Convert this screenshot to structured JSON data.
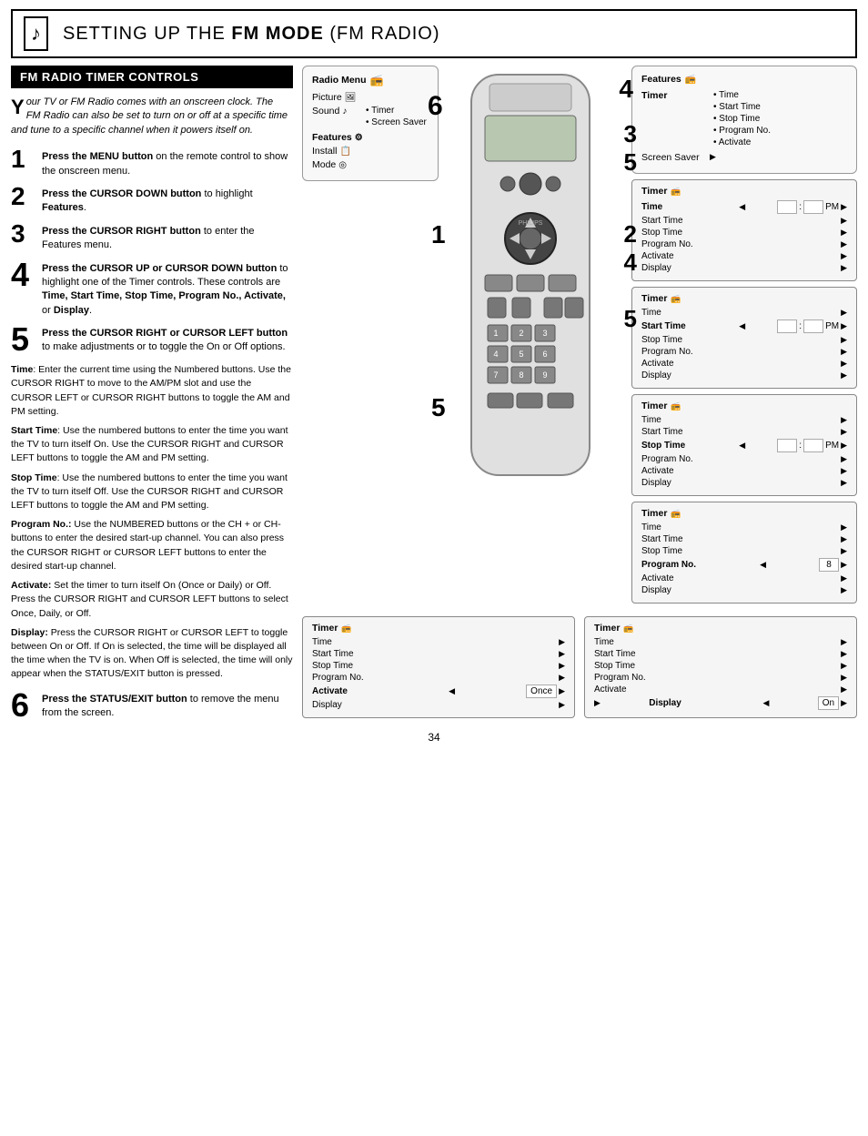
{
  "header": {
    "icon": "♪",
    "title_pre": "Setting up the ",
    "title_bold": "FM Mode",
    "title_post": " (FM Radio)"
  },
  "section_title": "FM Radio Timer Controls",
  "intro": {
    "drop_cap": "Y",
    "text": "our TV or FM Radio comes with an onscreen clock. The FM Radio can also be set to turn on or off at a specific time and tune to a specific channel when it powers itself on."
  },
  "steps": [
    {
      "num": "1",
      "text_bold": "Press the MENU button",
      "text": " on the remote control to show the onscreen menu."
    },
    {
      "num": "2",
      "text_bold": "Press the CURSOR DOWN button",
      "text": " to highlight ",
      "text_bold2": "Features",
      "text2": "."
    },
    {
      "num": "3",
      "text_bold": "Press the CURSOR RIGHT button",
      "text": " to enter the Features menu."
    },
    {
      "num": "4",
      "text_bold": "Press the CURSOR UP or CURSOR DOWN button",
      "text": " to highlight one of the Timer controls. These controls are ",
      "text_bold2": "Time, Start Time, Stop Time, Program No., Activate,",
      "text2": " or ",
      "text_bold3": "Display",
      "text3": "."
    },
    {
      "num": "5",
      "text_bold": "Press the CURSOR RIGHT or CURSOR LEFT button",
      "text": " to make adjustments or to toggle the On or Off options."
    }
  ],
  "details": [
    {
      "label": "Time",
      "text": ": Enter the current time using the Numbered buttons. Use the CURSOR RIGHT to move to the AM/PM slot and use the CURSOR LEFT or CURSOR RIGHT buttons to toggle the AM and PM setting."
    },
    {
      "label": "Start Time",
      "text": ": Use the numbered buttons to enter the time you want the TV to turn itself On. Use the CURSOR RIGHT and CURSOR LEFT buttons to toggle the AM and PM setting."
    },
    {
      "label": "Stop Time",
      "text": ": Use the numbered buttons to enter the time you want the TV to turn itself Off. Use the CURSOR RIGHT and CURSOR LEFT buttons to toggle the AM and PM setting."
    },
    {
      "label": "Program No.",
      "text": ": Use the NUMBERED buttons or the CH + or CH- buttons to enter the desired start-up channel.  You can also press the CURSOR RIGHT or CURSOR LEFT buttons to enter the desired start-up channel."
    },
    {
      "label": "Activate",
      "text": ": Set the timer to turn itself On (Once or Daily) or Off. Press the CURSOR RIGHT and CURSOR LEFT buttons to select Once, Daily, or Off."
    },
    {
      "label": "Display",
      "text": ": Press the CURSOR RIGHT or CURSOR LEFT to toggle between On or Off. If On is selected, the time will be displayed all the time when the TV is on. When Off is selected, the time will only appear when the STATUS/EXIT button is pressed."
    }
  ],
  "step6": {
    "num": "6",
    "text_bold": "Press the STATUS/EXIT button",
    "text": " to remove the menu from the screen."
  },
  "page_num": "34",
  "radio_menu": {
    "title": "Radio Menu",
    "items": [
      {
        "label": "Picture",
        "icon": "🖼",
        "options": []
      },
      {
        "label": "Sound",
        "icon": "♪",
        "options": []
      },
      {
        "label": "Features",
        "icon": "⚙",
        "options": [
          "Timer",
          "Screen Saver"
        ],
        "selected": true
      },
      {
        "label": "Install",
        "icon": "📋",
        "options": []
      },
      {
        "label": "Mode",
        "icon": "◎",
        "options": []
      }
    ]
  },
  "features_panel": {
    "title": "Features",
    "items": [
      {
        "label": "Timer",
        "bold": true,
        "options": [
          "Time",
          "Start Time",
          "Stop Time",
          "Program No.",
          "Activate"
        ]
      },
      {
        "label": "Screen Saver",
        "options": []
      }
    ]
  },
  "timer_panels": [
    {
      "title": "Timer",
      "rows": [
        {
          "label": "Time",
          "bold": true,
          "value": "PM",
          "has_value": true,
          "arrows": true
        },
        {
          "label": "Start Time",
          "arrow": true
        },
        {
          "label": "Stop Time",
          "arrow": true
        },
        {
          "label": "Program No.",
          "arrow": true
        },
        {
          "label": "Activate",
          "arrow": true
        },
        {
          "label": "Display",
          "arrow": true
        }
      ]
    },
    {
      "title": "Timer",
      "rows": [
        {
          "label": "Time",
          "arrow": true
        },
        {
          "label": "Start Time",
          "bold": true,
          "value": "PM",
          "has_value": true,
          "arrows": true
        },
        {
          "label": "Stop Time",
          "arrow": true
        },
        {
          "label": "Program No.",
          "arrow": true
        },
        {
          "label": "Activate",
          "arrow": true
        },
        {
          "label": "Display",
          "arrow": true
        }
      ]
    },
    {
      "title": "Timer",
      "rows": [
        {
          "label": "Time",
          "arrow": true
        },
        {
          "label": "Start Time",
          "arrow": true
        },
        {
          "label": "Stop Time",
          "bold": true,
          "value": "PM",
          "has_value": true,
          "arrows": true
        },
        {
          "label": "Program No.",
          "arrow": true
        },
        {
          "label": "Activate",
          "arrow": true
        },
        {
          "label": "Display",
          "arrow": true
        }
      ]
    },
    {
      "title": "Timer",
      "rows": [
        {
          "label": "Time",
          "arrow": true
        },
        {
          "label": "Start Time",
          "arrow": true
        },
        {
          "label": "Stop Time",
          "arrow": true
        },
        {
          "label": "Program No.",
          "bold": true,
          "value": "8",
          "has_num": true,
          "arrows": true
        },
        {
          "label": "Activate",
          "arrow": true
        },
        {
          "label": "Display",
          "arrow": true
        }
      ]
    }
  ],
  "bottom_panels": [
    {
      "title": "Timer",
      "rows": [
        {
          "label": "Time",
          "arrow": true
        },
        {
          "label": "Start Time",
          "arrow": true
        },
        {
          "label": "Stop Time",
          "arrow": true
        },
        {
          "label": "Program No.",
          "arrow": true
        },
        {
          "label": "Activate",
          "bold": true,
          "value": "Once",
          "arrows": true
        },
        {
          "label": "Display",
          "arrow": true
        }
      ]
    },
    {
      "title": "Timer",
      "rows": [
        {
          "label": "Time",
          "arrow": true
        },
        {
          "label": "Start Time",
          "arrow": true
        },
        {
          "label": "Stop Time",
          "arrow": true
        },
        {
          "label": "Program No.",
          "arrow": true
        },
        {
          "label": "Activate",
          "arrow": true
        },
        {
          "label": "Display",
          "bold": true,
          "value": "On",
          "arrow_left": true,
          "arrows": true
        }
      ]
    }
  ]
}
